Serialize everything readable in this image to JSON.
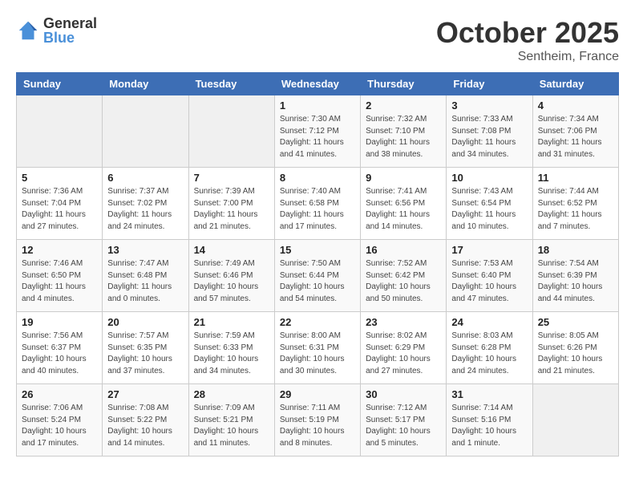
{
  "header": {
    "logo_general": "General",
    "logo_blue": "Blue",
    "title": "October 2025",
    "subtitle": "Sentheim, France"
  },
  "days_of_week": [
    "Sunday",
    "Monday",
    "Tuesday",
    "Wednesday",
    "Thursday",
    "Friday",
    "Saturday"
  ],
  "weeks": [
    [
      {
        "day": "",
        "info": ""
      },
      {
        "day": "",
        "info": ""
      },
      {
        "day": "",
        "info": ""
      },
      {
        "day": "1",
        "info": "Sunrise: 7:30 AM\nSunset: 7:12 PM\nDaylight: 11 hours\nand 41 minutes."
      },
      {
        "day": "2",
        "info": "Sunrise: 7:32 AM\nSunset: 7:10 PM\nDaylight: 11 hours\nand 38 minutes."
      },
      {
        "day": "3",
        "info": "Sunrise: 7:33 AM\nSunset: 7:08 PM\nDaylight: 11 hours\nand 34 minutes."
      },
      {
        "day": "4",
        "info": "Sunrise: 7:34 AM\nSunset: 7:06 PM\nDaylight: 11 hours\nand 31 minutes."
      }
    ],
    [
      {
        "day": "5",
        "info": "Sunrise: 7:36 AM\nSunset: 7:04 PM\nDaylight: 11 hours\nand 27 minutes."
      },
      {
        "day": "6",
        "info": "Sunrise: 7:37 AM\nSunset: 7:02 PM\nDaylight: 11 hours\nand 24 minutes."
      },
      {
        "day": "7",
        "info": "Sunrise: 7:39 AM\nSunset: 7:00 PM\nDaylight: 11 hours\nand 21 minutes."
      },
      {
        "day": "8",
        "info": "Sunrise: 7:40 AM\nSunset: 6:58 PM\nDaylight: 11 hours\nand 17 minutes."
      },
      {
        "day": "9",
        "info": "Sunrise: 7:41 AM\nSunset: 6:56 PM\nDaylight: 11 hours\nand 14 minutes."
      },
      {
        "day": "10",
        "info": "Sunrise: 7:43 AM\nSunset: 6:54 PM\nDaylight: 11 hours\nand 10 minutes."
      },
      {
        "day": "11",
        "info": "Sunrise: 7:44 AM\nSunset: 6:52 PM\nDaylight: 11 hours\nand 7 minutes."
      }
    ],
    [
      {
        "day": "12",
        "info": "Sunrise: 7:46 AM\nSunset: 6:50 PM\nDaylight: 11 hours\nand 4 minutes."
      },
      {
        "day": "13",
        "info": "Sunrise: 7:47 AM\nSunset: 6:48 PM\nDaylight: 11 hours\nand 0 minutes."
      },
      {
        "day": "14",
        "info": "Sunrise: 7:49 AM\nSunset: 6:46 PM\nDaylight: 10 hours\nand 57 minutes."
      },
      {
        "day": "15",
        "info": "Sunrise: 7:50 AM\nSunset: 6:44 PM\nDaylight: 10 hours\nand 54 minutes."
      },
      {
        "day": "16",
        "info": "Sunrise: 7:52 AM\nSunset: 6:42 PM\nDaylight: 10 hours\nand 50 minutes."
      },
      {
        "day": "17",
        "info": "Sunrise: 7:53 AM\nSunset: 6:40 PM\nDaylight: 10 hours\nand 47 minutes."
      },
      {
        "day": "18",
        "info": "Sunrise: 7:54 AM\nSunset: 6:39 PM\nDaylight: 10 hours\nand 44 minutes."
      }
    ],
    [
      {
        "day": "19",
        "info": "Sunrise: 7:56 AM\nSunset: 6:37 PM\nDaylight: 10 hours\nand 40 minutes."
      },
      {
        "day": "20",
        "info": "Sunrise: 7:57 AM\nSunset: 6:35 PM\nDaylight: 10 hours\nand 37 minutes."
      },
      {
        "day": "21",
        "info": "Sunrise: 7:59 AM\nSunset: 6:33 PM\nDaylight: 10 hours\nand 34 minutes."
      },
      {
        "day": "22",
        "info": "Sunrise: 8:00 AM\nSunset: 6:31 PM\nDaylight: 10 hours\nand 30 minutes."
      },
      {
        "day": "23",
        "info": "Sunrise: 8:02 AM\nSunset: 6:29 PM\nDaylight: 10 hours\nand 27 minutes."
      },
      {
        "day": "24",
        "info": "Sunrise: 8:03 AM\nSunset: 6:28 PM\nDaylight: 10 hours\nand 24 minutes."
      },
      {
        "day": "25",
        "info": "Sunrise: 8:05 AM\nSunset: 6:26 PM\nDaylight: 10 hours\nand 21 minutes."
      }
    ],
    [
      {
        "day": "26",
        "info": "Sunrise: 7:06 AM\nSunset: 5:24 PM\nDaylight: 10 hours\nand 17 minutes."
      },
      {
        "day": "27",
        "info": "Sunrise: 7:08 AM\nSunset: 5:22 PM\nDaylight: 10 hours\nand 14 minutes."
      },
      {
        "day": "28",
        "info": "Sunrise: 7:09 AM\nSunset: 5:21 PM\nDaylight: 10 hours\nand 11 minutes."
      },
      {
        "day": "29",
        "info": "Sunrise: 7:11 AM\nSunset: 5:19 PM\nDaylight: 10 hours\nand 8 minutes."
      },
      {
        "day": "30",
        "info": "Sunrise: 7:12 AM\nSunset: 5:17 PM\nDaylight: 10 hours\nand 5 minutes."
      },
      {
        "day": "31",
        "info": "Sunrise: 7:14 AM\nSunset: 5:16 PM\nDaylight: 10 hours\nand 1 minute."
      },
      {
        "day": "",
        "info": ""
      }
    ]
  ]
}
